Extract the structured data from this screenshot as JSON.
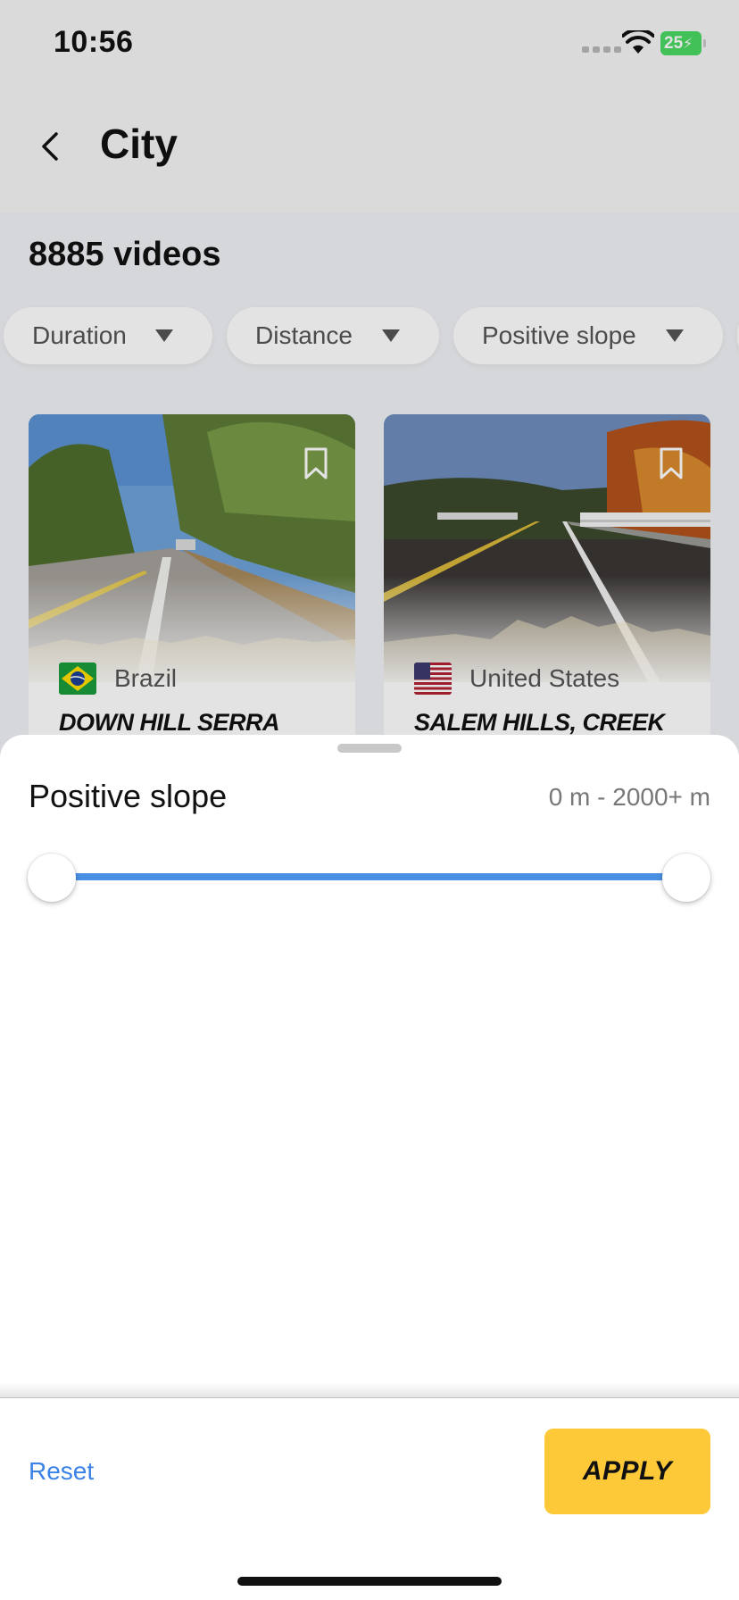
{
  "status": {
    "time": "10:56",
    "battery": "25"
  },
  "header": {
    "title": "City"
  },
  "results": {
    "count_label": "8885 videos"
  },
  "filters": [
    {
      "label": "Duration"
    },
    {
      "label": "Distance"
    },
    {
      "label": "Positive slope"
    }
  ],
  "cards": [
    {
      "country": "Brazil",
      "title": "DOWN HILL SERRA"
    },
    {
      "country": "United States",
      "title": "SALEM HILLS, CREEK"
    }
  ],
  "sheet": {
    "title": "Positive slope",
    "range_label": "0 m - 2000+ m",
    "slider": {
      "min_fraction": 0.0,
      "max_fraction": 1.0
    },
    "accent_color": "#4a90e2"
  },
  "footer": {
    "reset_label": "Reset",
    "apply_label": "APPLY",
    "apply_color": "#fdc938"
  }
}
